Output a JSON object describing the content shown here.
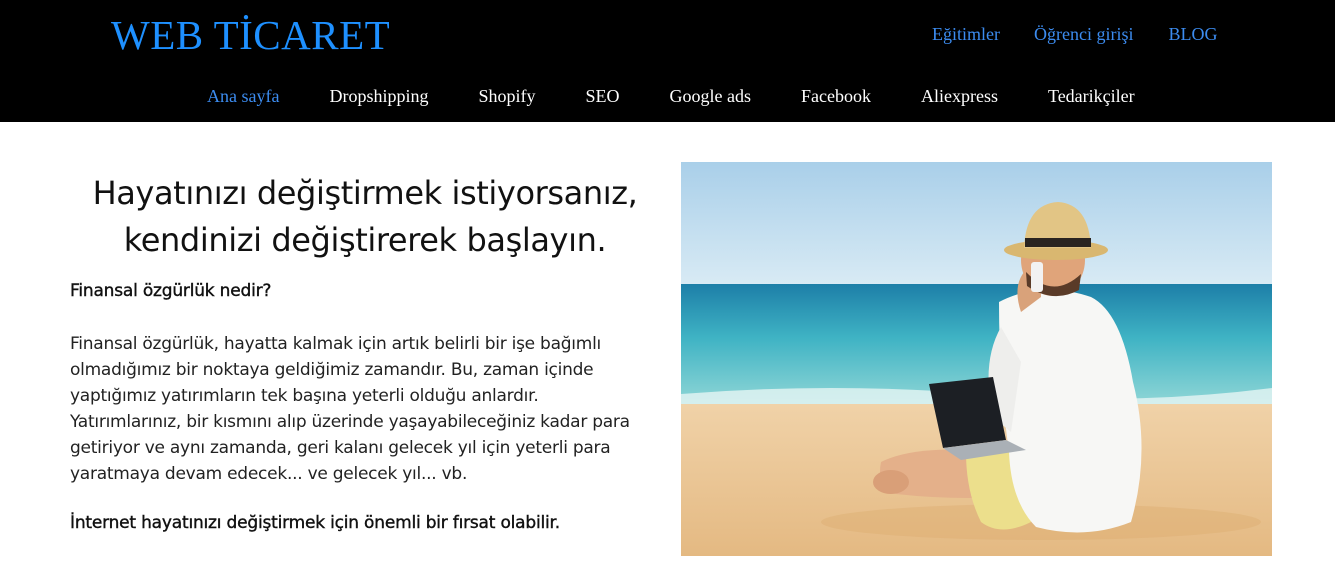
{
  "header": {
    "logo": "WEB TİCARET",
    "top_links": [
      "Eğitimler",
      "Öğrenci girişi",
      "BLOG"
    ],
    "nav": [
      {
        "label": "Ana sayfa",
        "active": true
      },
      {
        "label": "Dropshipping",
        "active": false
      },
      {
        "label": "Shopify",
        "active": false
      },
      {
        "label": "SEO",
        "active": false
      },
      {
        "label": "Google ads",
        "active": false
      },
      {
        "label": "Facebook",
        "active": false
      },
      {
        "label": "Aliexpress",
        "active": false
      },
      {
        "label": "Tedarikçiler",
        "active": false
      }
    ]
  },
  "content": {
    "heading_line1": "Hayatınızı değiştirmek istiyorsanız,",
    "heading_line2": "kendinizi değiştirerek başlayın.",
    "subheading": "Finansal özgürlük nedir?",
    "paragraph": "Finansal özgürlük, hayatta kalmak için artık belirli bir işe bağımlı olmadığımız bir noktaya geldiğimiz zamandır. Bu, zaman içinde yaptığımız yatırımların tek başına yeterli olduğu anlardır. Yatırımlarınız, bir kısmını alıp üzerinde yaşayabileceğiniz kadar para getiriyor ve aynı zamanda, geri kalanı gelecek yıl için yeterli para yaratmaya devam edecek... ve gelecek yıl... vb.",
    "cta": "İnternet hayatınızı değiştirmek için önemli bir fırsat olabilir."
  },
  "colors": {
    "header_bg": "#000000",
    "accent": "#3c8cf0",
    "logo": "#1e90ff"
  }
}
